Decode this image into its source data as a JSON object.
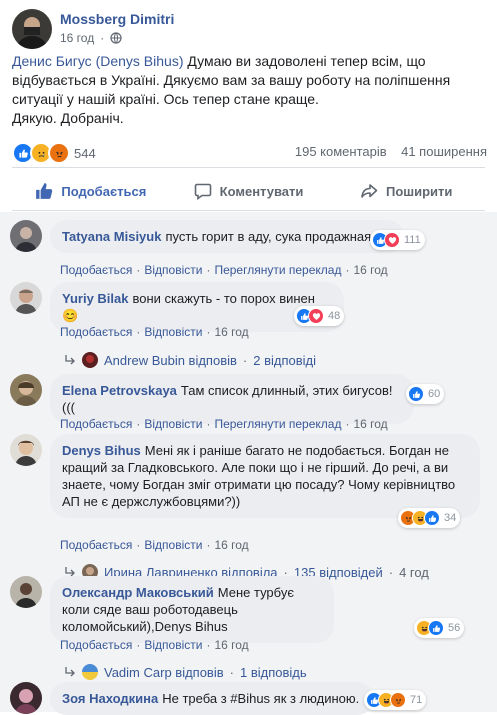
{
  "post": {
    "author": "Mossberg Dimitri",
    "time": "16 год",
    "text_pre": "Денис Бигус ",
    "text_link": "(Denys Bihus)",
    "text_line1": " Думаю ви задоволені тепер всім, що відбувається в Україні. Дякуємо вам за вашу роботу на поліпшення ситуації у нашій країні. Ось тепер стане краще.",
    "text_line2": "Дякую. Добраніч.",
    "reaction_count": "544",
    "comments_count": "195 коментарів",
    "shares_count": "41 поширення"
  },
  "actions": {
    "like": "Подобається",
    "comment": "Коментувати",
    "share": "Поширити"
  },
  "links": {
    "like": "Подобається",
    "reply": "Відповісти",
    "translate": "Переглянути переклад"
  },
  "comments": [
    {
      "name": "Tatyana Misiyuk",
      "text": "пусть горит в аду, сука продажная",
      "count": "111",
      "time": "16 год"
    },
    {
      "name": "Yuriy Bilak",
      "text": "вони скажуть - то порох винен 😊",
      "count": "48",
      "time": "16 год",
      "reply": {
        "who": "Andrew Bubin відповів",
        "count": "2 відповіді"
      }
    },
    {
      "name": "Elena Petrovskaya",
      "text": "Там список длинный, этих бигусов!(((",
      "count": "60",
      "time": "16 год"
    },
    {
      "name": "Denys Bihus",
      "text": "Мені як і раніше багато не подобається. Богдан не кращий за Гладковського. Але поки що і не гірший. До речі, а ви знаете, чому Богдан зміг отримати цю посаду? Чому керівництво АП не є держслужбовцями?))",
      "count": "34",
      "time": "16 год",
      "reply": {
        "who": "Ирина Лавриненко відповіла",
        "count": "135 відповідей",
        "time": "4 год"
      }
    },
    {
      "name": "Олександр Маковський",
      "text": "Мене турбує коли сяде ваш роботодавець коломойський),Denys Bihus",
      "count": "56",
      "time": "16 год",
      "reply": {
        "who": "Vadim Carp відповів",
        "count": "1 відповідь"
      }
    },
    {
      "name": "Зоя Находкина",
      "text": "Не треба з #Bihus як з людиною.",
      "count": "71"
    }
  ],
  "colors": {
    "link": "#385898",
    "like_blue": "#4267b2",
    "bg_comments": "#f2f3f5",
    "bubble": "#ebedf0"
  }
}
